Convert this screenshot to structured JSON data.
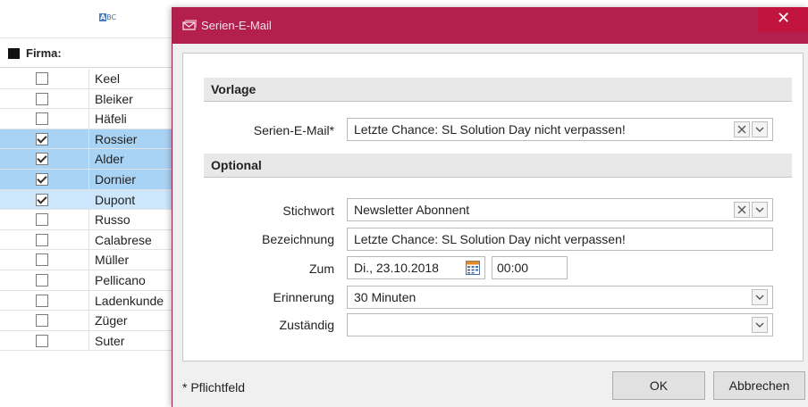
{
  "grid": {
    "group_label": "Firma:",
    "rows": [
      {
        "name": "Keel",
        "checked": false,
        "state": ""
      },
      {
        "name": "Bleiker",
        "checked": false,
        "state": ""
      },
      {
        "name": "Häfeli",
        "checked": false,
        "state": ""
      },
      {
        "name": "Rossier",
        "checked": true,
        "state": "sel"
      },
      {
        "name": "Alder",
        "checked": true,
        "state": "sel"
      },
      {
        "name": "Dornier",
        "checked": true,
        "state": "sel"
      },
      {
        "name": "Dupont",
        "checked": true,
        "state": "sel-light"
      },
      {
        "name": "Russo",
        "checked": false,
        "state": ""
      },
      {
        "name": "Calabrese",
        "checked": false,
        "state": ""
      },
      {
        "name": "Müller",
        "checked": false,
        "state": ""
      },
      {
        "name": "Pellicano",
        "checked": false,
        "state": ""
      },
      {
        "name": "Ladenkunde",
        "checked": false,
        "state": ""
      },
      {
        "name": "Züger",
        "checked": false,
        "state": ""
      },
      {
        "name": "Suter",
        "checked": false,
        "state": ""
      }
    ]
  },
  "dialog": {
    "title": "Serien-E-Mail",
    "close_symbol": "✕",
    "sections": {
      "vorlage": "Vorlage",
      "optional": "Optional"
    },
    "fields": {
      "serien_email": {
        "label": "Serien-E-Mail*",
        "value": "Letzte Chance: SL Solution Day nicht verpassen!"
      },
      "stichwort": {
        "label": "Stichwort",
        "value": "Newsletter Abonnent"
      },
      "bezeichnung": {
        "label": "Bezeichnung",
        "value": "Letzte Chance: SL Solution Day nicht verpassen!"
      },
      "zum": {
        "label": "Zum",
        "date": "Di., 23.10.2018",
        "time": "00:00"
      },
      "erinnerung": {
        "label": "Erinnerung",
        "value": "30 Minuten"
      },
      "zustaendig": {
        "label": "Zuständig",
        "value": ""
      }
    },
    "footer": {
      "required_note": "* Pflichtfeld",
      "ok_label": "OK",
      "cancel_label": "Abbrechen"
    }
  },
  "colors": {
    "titlebar": "#b3204f",
    "close_button": "#c1143f",
    "selected_row": "#a9d3f5"
  }
}
